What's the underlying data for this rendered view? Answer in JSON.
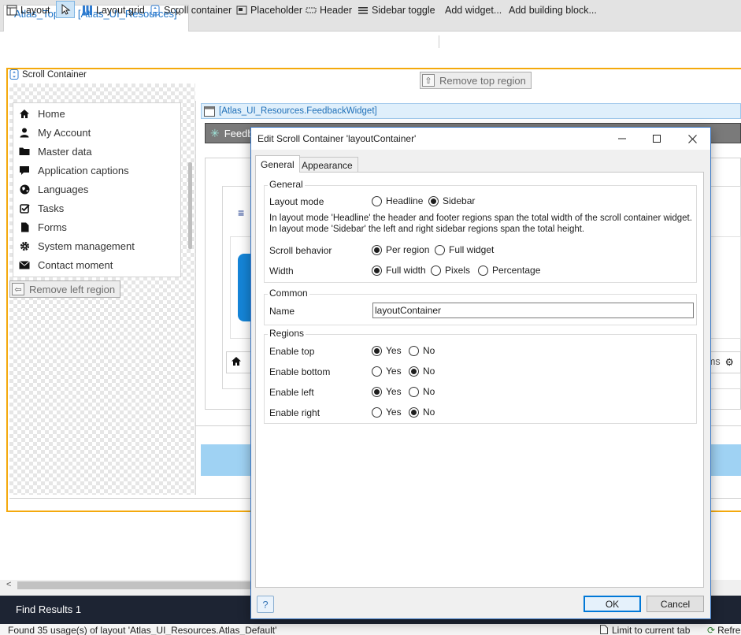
{
  "tab": {
    "title": "Atlas_TopBar [Atlas_UI_Resources]",
    "close": "×"
  },
  "toolbar": {
    "layout": "Layout",
    "layout_grid": "Layout grid",
    "scroll_container": "Scroll container",
    "placeholder": "Placeholder",
    "header": "Header",
    "sidebar_toggle": "Sidebar toggle",
    "add_widget": "Add widget...",
    "add_building_block": "Add building block..."
  },
  "canvas": {
    "scroll_container_label": "Scroll Container",
    "remove_top": "Remove top region",
    "remove_left": "Remove left region",
    "feedback_widget_label": "[Atlas_UI_Resources.FeedbackWidget]",
    "feedback_widget_text": "Feedb",
    "breadcrumb_right": "ms",
    "menu": [
      {
        "label": "Home",
        "icon": "home-icon"
      },
      {
        "label": "My Account",
        "icon": "user-icon"
      },
      {
        "label": "Master data",
        "icon": "folder-icon"
      },
      {
        "label": "Application captions",
        "icon": "comment-icon"
      },
      {
        "label": "Languages",
        "icon": "globe-icon"
      },
      {
        "label": "Tasks",
        "icon": "check-square-icon"
      },
      {
        "label": "Forms",
        "icon": "file-icon"
      },
      {
        "label": "System management",
        "icon": "gear-icon"
      },
      {
        "label": "Contact moment",
        "icon": "envelope-icon"
      }
    ]
  },
  "dialog": {
    "title": "Edit Scroll Container 'layoutContainer'",
    "tabs": {
      "general": "General",
      "appearance": "Appearance"
    },
    "general_group": {
      "title": "General",
      "layout_mode_label": "Layout mode",
      "layout_mode_options": [
        "Headline",
        "Sidebar"
      ],
      "layout_mode_selected": "Sidebar",
      "help_line1": "In layout mode 'Headline' the header and footer regions span the total width of the scroll container widget.",
      "help_line2": "In layout mode 'Sidebar' the left and right sidebar regions span the total height.",
      "scroll_behavior_label": "Scroll behavior",
      "scroll_behavior_options": [
        "Per region",
        "Full widget"
      ],
      "scroll_behavior_selected": "Per region",
      "width_label": "Width",
      "width_options": [
        "Full width",
        "Pixels",
        "Percentage"
      ],
      "width_selected": "Full width"
    },
    "common_group": {
      "title": "Common",
      "name_label": "Name",
      "name_value": "layoutContainer"
    },
    "regions_group": {
      "title": "Regions",
      "yes": "Yes",
      "no": "No",
      "enable_top": "Enable top",
      "enable_bottom": "Enable bottom",
      "enable_left": "Enable left",
      "enable_right": "Enable right"
    },
    "ok": "OK",
    "cancel": "Cancel",
    "help": "?"
  },
  "bottom": {
    "find_results": "Find Results 1",
    "status": "Found 35 usage(s) of layout 'Atlas_UI_Resources.Atlas_Default'",
    "limit": "Limit to current tab",
    "refresh": "Refre"
  },
  "colors": {
    "accent": "#1e74c8",
    "selection_border": "#f4a90c",
    "dark_panel": "#1d2433",
    "dialog_border": "#3b78c4"
  }
}
